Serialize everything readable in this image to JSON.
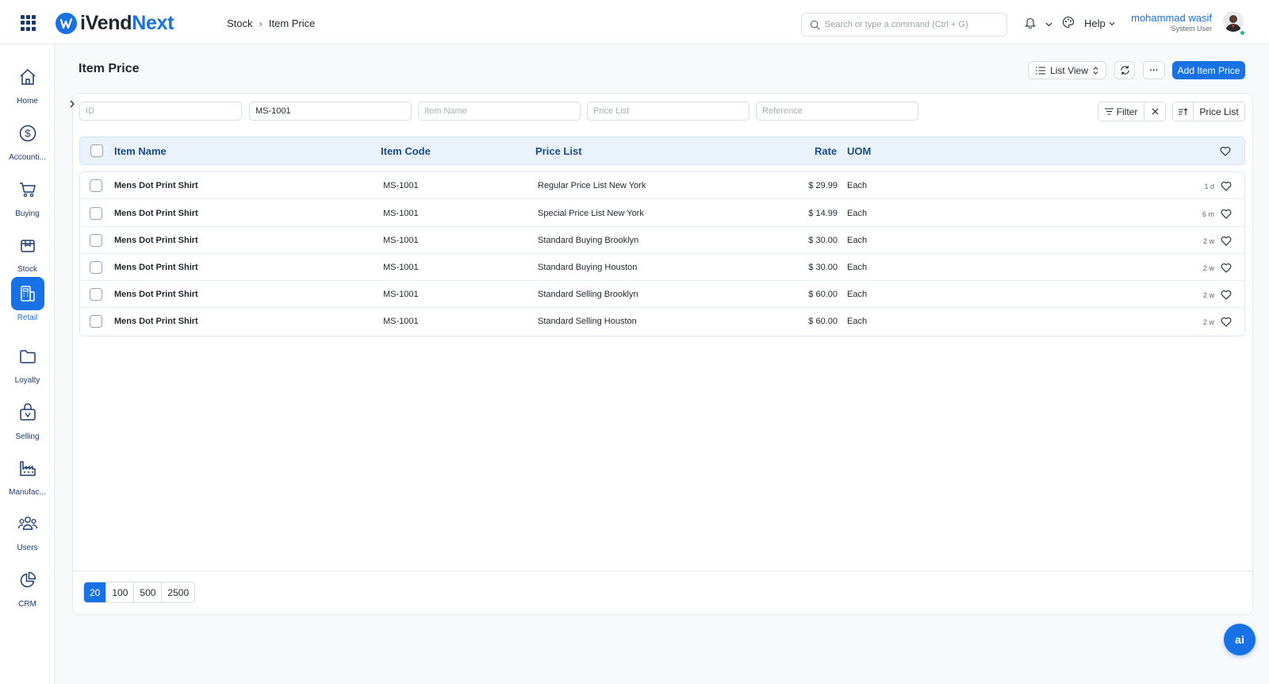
{
  "app": {
    "brand_prefix": "iVend",
    "brand_suffix": "Next",
    "accent_color": "#1872e6"
  },
  "breadcrumb": {
    "parent": "Stock",
    "current": "Item Price"
  },
  "search": {
    "placeholder": "Search or type a command (Ctrl + G)"
  },
  "topbar": {
    "help_label": "Help"
  },
  "user": {
    "name": "mohammad wasif",
    "role": "System User"
  },
  "sidebar": {
    "items": [
      {
        "label": "Home",
        "icon": "home-icon"
      },
      {
        "label": "Accounti...",
        "icon": "dollar-circle-icon"
      },
      {
        "label": "Buying",
        "icon": "cart-icon"
      },
      {
        "label": "Stock",
        "icon": "box-icon"
      },
      {
        "label": "Retail",
        "icon": "retail-icon",
        "active": true
      },
      {
        "label": "Loyalty",
        "icon": "folder-icon"
      },
      {
        "label": "Selling",
        "icon": "selling-icon"
      },
      {
        "label": "Manufac...",
        "icon": "factory-icon"
      },
      {
        "label": "Users",
        "icon": "users-icon"
      },
      {
        "label": "CRM",
        "icon": "pie-chart-icon"
      }
    ]
  },
  "page": {
    "title": "Item Price",
    "list_view_label": "List View",
    "more_label": "···",
    "add_label": "Add Item Price"
  },
  "filters": {
    "id_placeholder": "ID",
    "item_code_value": "MS-1001",
    "item_name_placeholder": "Item Name",
    "price_list_placeholder": "Price List",
    "reference_placeholder": "Reference",
    "filter_label": "Filter",
    "sort_label": "Price List"
  },
  "table": {
    "columns": {
      "item_name": "Item Name",
      "item_code": "Item Code",
      "price_list": "Price List",
      "rate": "Rate",
      "uom": "UOM"
    },
    "rows": [
      {
        "item_name": "Mens Dot Print Shirt",
        "item_code": "MS-1001",
        "price_list": "Regular Price List New York",
        "rate": "$ 29.99",
        "uom": "Each",
        "modified": "1 d"
      },
      {
        "item_name": "Mens Dot Print Shirt",
        "item_code": "MS-1001",
        "price_list": "Special Price List New York",
        "rate": "$ 14.99",
        "uom": "Each",
        "modified": "6 m"
      },
      {
        "item_name": "Mens Dot Print Shirt",
        "item_code": "MS-1001",
        "price_list": "Standard Buying Brooklyn",
        "rate": "$ 30.00",
        "uom": "Each",
        "modified": "2 w"
      },
      {
        "item_name": "Mens Dot Print Shirt",
        "item_code": "MS-1001",
        "price_list": "Standard Buying Houston",
        "rate": "$ 30.00",
        "uom": "Each",
        "modified": "2 w"
      },
      {
        "item_name": "Mens Dot Print Shirt",
        "item_code": "MS-1001",
        "price_list": "Standard Selling Brooklyn",
        "rate": "$ 60.00",
        "uom": "Each",
        "modified": "2 w"
      },
      {
        "item_name": "Mens Dot Print Shirt",
        "item_code": "MS-1001",
        "price_list": "Standard Selling Houston",
        "rate": "$ 60.00",
        "uom": "Each",
        "modified": "2 w"
      }
    ]
  },
  "pagination": {
    "sizes": [
      "20",
      "100",
      "500",
      "2500"
    ],
    "selected": "20"
  },
  "fab": {
    "label": "ai"
  }
}
